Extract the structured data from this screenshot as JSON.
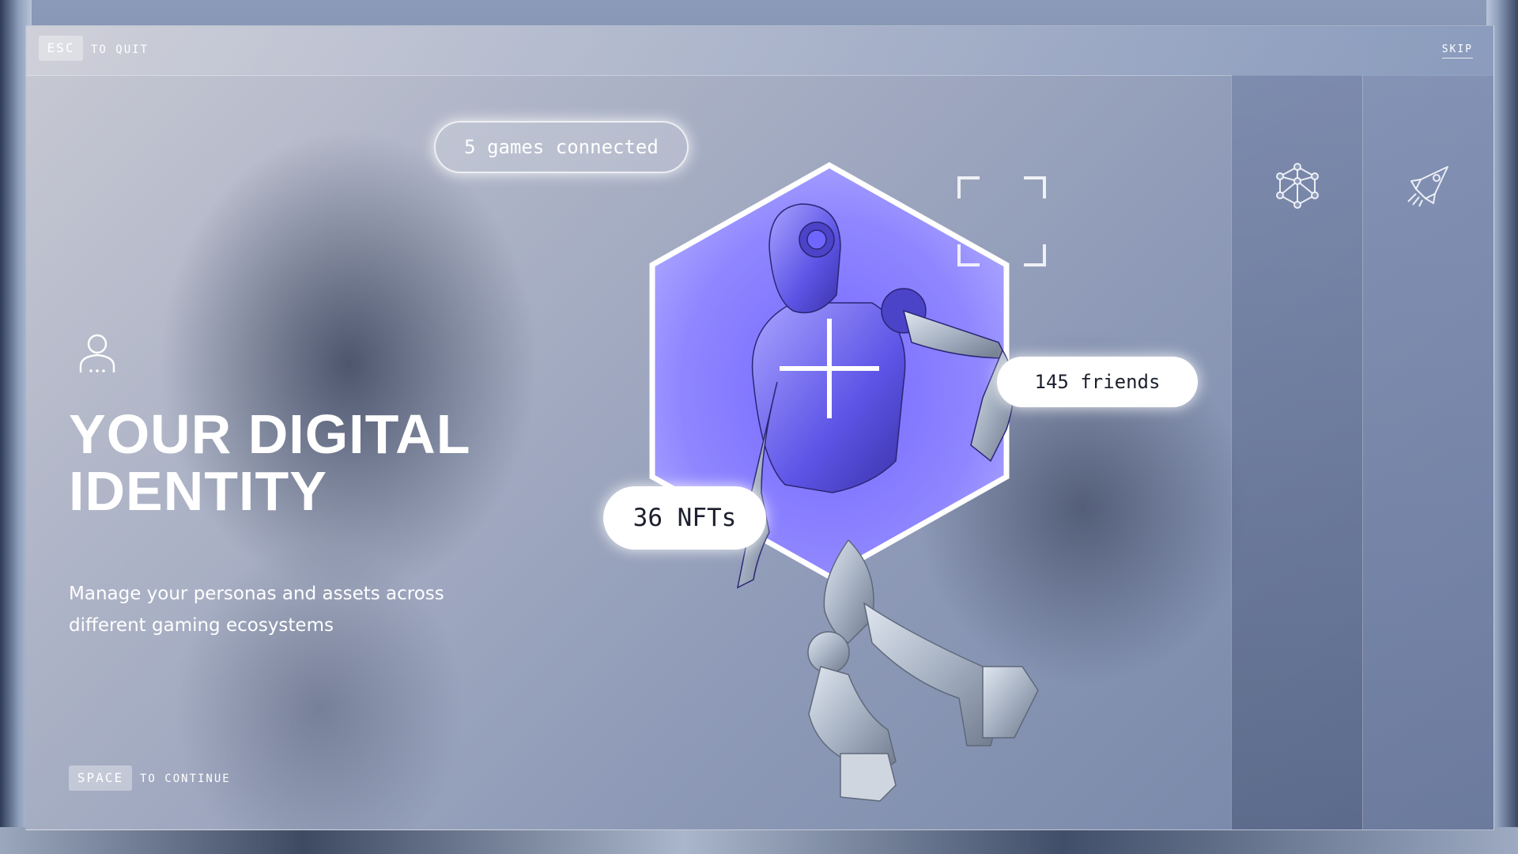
{
  "controls": {
    "quit_key": "ESC",
    "quit_text": "TO QUIT",
    "skip_label": "SKIP",
    "continue_key": "SPACE",
    "continue_text": "TO CONTINUE"
  },
  "hero": {
    "title_line1": "YOUR DIGITAL",
    "title_line2": "IDENTITY",
    "subtitle": "Manage your personas and assets across different gaming ecosystems"
  },
  "stats": {
    "games": "5 games connected",
    "friends": "145 friends",
    "nfts": "36 NFTs"
  },
  "icons": {
    "persona": "user-avatar-icon",
    "network": "network-cube-icon",
    "rocket": "rocket-icon",
    "scan": "scan-frame-icon",
    "crosshair": "crosshair-icon"
  },
  "colors": {
    "accent": "#7b6bff",
    "hexagon_fill": "#8f86ff",
    "robot_body": "#b9c3d2"
  }
}
